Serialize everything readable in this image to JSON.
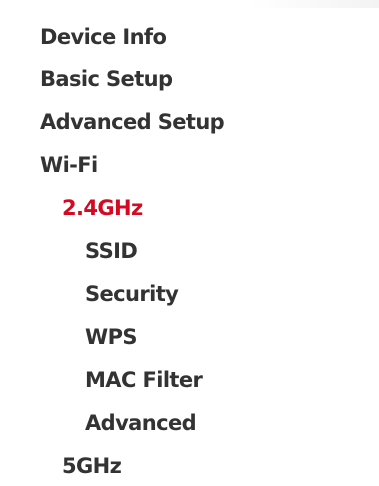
{
  "menu": {
    "device_info": "Device Info",
    "basic_setup": "Basic Setup",
    "advanced_setup": "Advanced Setup",
    "wifi": "Wi-Fi",
    "wifi_24": "2.4GHz",
    "ssid": "SSID",
    "security": "Security",
    "wps": "WPS",
    "mac_filter": "MAC Filter",
    "advanced": "Advanced",
    "wifi_5": "5GHz"
  },
  "colors": {
    "text": "#333333",
    "active": "#d40a22",
    "background": "#ffffff"
  },
  "active_item": "2.4GHz"
}
